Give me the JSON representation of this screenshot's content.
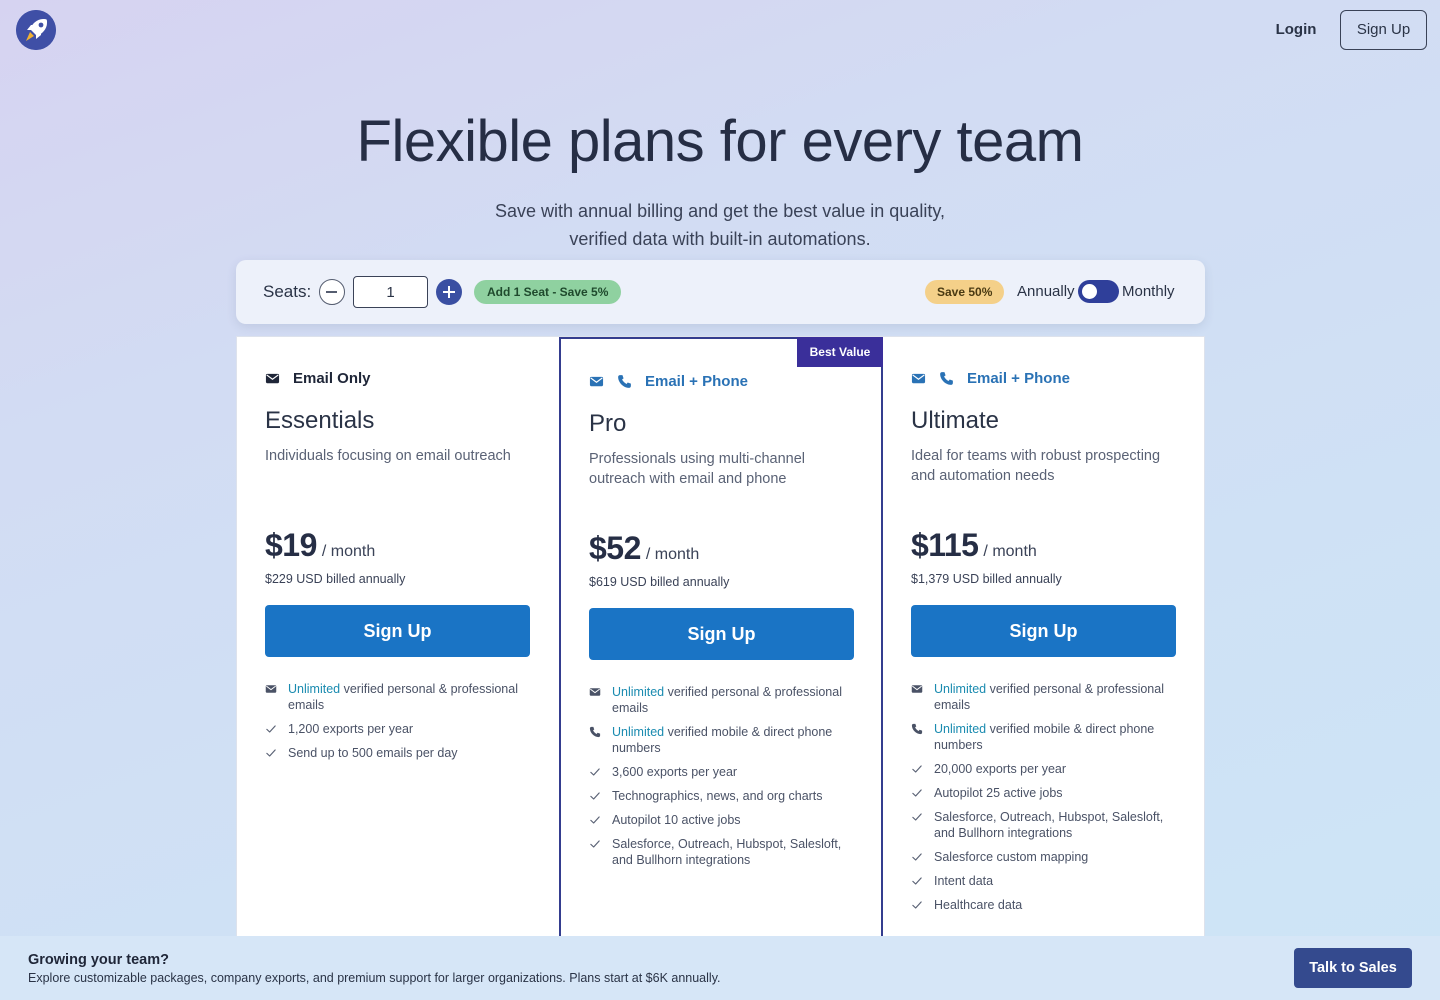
{
  "header": {
    "logo_icon": "rocket-icon",
    "login_label": "Login",
    "signup_label": "Sign Up"
  },
  "hero": {
    "title": "Flexible plans for every team",
    "subtitle_line1": "Save with annual billing and get the best value in quality,",
    "subtitle_line2": "verified data with built-in automations."
  },
  "seat_bar": {
    "label": "Seats:",
    "value": "1",
    "add_badge": "Add 1 Seat - Save 5%",
    "save_badge": "Save 50%",
    "annually_label": "Annually",
    "monthly_label": "Monthly",
    "toggle_state": "annually"
  },
  "colors": {
    "accent": "#1a74c5",
    "highlight": "#1a8bb0",
    "best_value_bg": "#3a2f9a",
    "badge_green": "#8fd1a0",
    "badge_yellow": "#f4d089"
  },
  "plans": [
    {
      "channel": "Email Only",
      "channel_icons": [
        "envelope-icon"
      ],
      "name": "Essentials",
      "description": "Individuals focusing on email outreach",
      "price": "$19",
      "per": "/ month",
      "billed": "$229 USD billed annually",
      "cta": "Sign Up",
      "features": [
        {
          "icon": "envelope-icon",
          "highlight": "Unlimited",
          "text": " verified personal & professional emails"
        },
        {
          "icon": "check-icon",
          "highlight": "",
          "text": "1,200 exports per year"
        },
        {
          "icon": "check-icon",
          "highlight": "",
          "text": "Send up to 500 emails per day"
        }
      ]
    },
    {
      "badge": "Best Value",
      "channel": "Email + Phone",
      "channel_icons": [
        "envelope-icon",
        "phone-icon"
      ],
      "name": "Pro",
      "description": "Professionals using multi-channel outreach with email and phone",
      "price": "$52",
      "per": "/ month",
      "billed": "$619 USD billed annually",
      "cta": "Sign Up",
      "features": [
        {
          "icon": "envelope-icon",
          "highlight": "Unlimited",
          "text": " verified personal & professional emails"
        },
        {
          "icon": "phone-icon",
          "highlight": "Unlimited",
          "text": " verified mobile & direct phone numbers"
        },
        {
          "icon": "check-icon",
          "highlight": "",
          "text": "3,600 exports per year"
        },
        {
          "icon": "check-icon",
          "highlight": "",
          "text": "Technographics, news, and org charts"
        },
        {
          "icon": "check-icon",
          "highlight": "",
          "text": "Autopilot 10 active jobs"
        },
        {
          "icon": "check-icon",
          "highlight": "",
          "text": "Salesforce, Outreach, Hubspot, Salesloft, and Bullhorn integrations"
        }
      ]
    },
    {
      "channel": "Email + Phone",
      "channel_icons": [
        "envelope-icon",
        "phone-icon"
      ],
      "name": "Ultimate",
      "description": "Ideal for teams with robust prospecting and automation needs",
      "price": "$115",
      "per": "/ month",
      "billed": "$1,379 USD billed annually",
      "cta": "Sign Up",
      "features": [
        {
          "icon": "envelope-icon",
          "highlight": "Unlimited",
          "text": " verified personal & professional emails"
        },
        {
          "icon": "phone-icon",
          "highlight": "Unlimited",
          "text": " verified mobile & direct phone numbers"
        },
        {
          "icon": "check-icon",
          "highlight": "",
          "text": "20,000 exports per year"
        },
        {
          "icon": "check-icon",
          "highlight": "",
          "text": "Autopilot 25 active jobs"
        },
        {
          "icon": "check-icon",
          "highlight": "",
          "text": "Salesforce, Outreach, Hubspot, Salesloft, and Bullhorn integrations"
        },
        {
          "icon": "check-icon",
          "highlight": "",
          "text": "Salesforce custom mapping"
        },
        {
          "icon": "check-icon",
          "highlight": "",
          "text": "Intent data"
        },
        {
          "icon": "check-icon",
          "highlight": "",
          "text": "Healthcare data"
        }
      ]
    }
  ],
  "footer": {
    "title": "Growing your team?",
    "text": "Explore customizable packages, company exports, and premium support for larger organizations. Plans start at $6K annually.",
    "cta": "Talk to Sales"
  }
}
